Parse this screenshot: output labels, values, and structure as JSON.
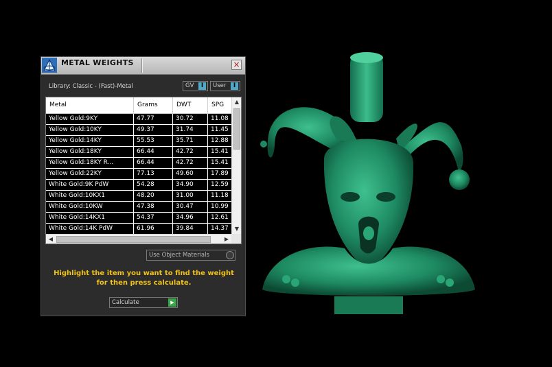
{
  "window": {
    "title": "METAL WEIGHTS",
    "close_label": "×",
    "logo_icon": "metal-weights-logo-icon"
  },
  "library": {
    "label": "Library: Classic - (Fast)-Metal",
    "gv_label": "GV",
    "user_label": "User",
    "toggle_glyph": "I"
  },
  "table": {
    "headers": [
      "Metal",
      "Grams",
      "DWT",
      "SPG"
    ],
    "rows": [
      [
        "Yellow Gold:9KY",
        "47.77",
        "30.72",
        "11.08"
      ],
      [
        "Yellow Gold:10KY",
        "49.37",
        "31.74",
        "11.45"
      ],
      [
        "Yellow Gold:14KY",
        "55.53",
        "35.71",
        "12.88"
      ],
      [
        "Yellow Gold:18KY",
        "66.44",
        "42.72",
        "15.41"
      ],
      [
        "Yellow Gold:18KY R...",
        "66.44",
        "42.72",
        "15.41"
      ],
      [
        "Yellow Gold:22KY",
        "77.13",
        "49.60",
        "17.89"
      ],
      [
        "White Gold:9K PdW",
        "54.28",
        "34.90",
        "12.59"
      ],
      [
        "White Gold:10KX1",
        "48.20",
        "31.00",
        "11.18"
      ],
      [
        "White Gold:10KW",
        "47.38",
        "30.47",
        "10.99"
      ],
      [
        "White Gold:14KX1",
        "54.37",
        "34.96",
        "12.61"
      ],
      [
        "White Gold:14K PdW",
        "61.96",
        "39.84",
        "14.37"
      ]
    ]
  },
  "controls": {
    "use_object_materials": "Use Object Materials",
    "hint": "Highlight the item you want to find the weight for then press calculate.",
    "calculate_label": "Calculate"
  },
  "colors": {
    "accent_blue": "#4fa8c8",
    "hint_yellow": "#f0c218",
    "model_green": "#1e8a62",
    "play_green": "#3aa64a"
  },
  "viewport": {
    "model_icon": "jester-pendant-3d-model"
  }
}
